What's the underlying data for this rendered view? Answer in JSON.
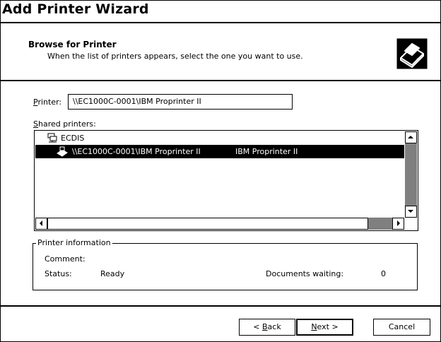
{
  "window": {
    "title": "Add Printer Wizard"
  },
  "header": {
    "title": "Browse for Printer",
    "subtitle": "When the list of printers appears, select the one you want to use.",
    "icon": "printer-icon"
  },
  "printer_field": {
    "label_access": "P",
    "label_rest": "rinter:",
    "value": "\\\\EC1000C-0001\\IBM Proprinter II"
  },
  "shared_printers": {
    "label_access": "S",
    "label_rest": "hared printers:",
    "items": [
      {
        "name": "ECDIS",
        "description": "",
        "icon": "network-domain-icon",
        "selected": false
      },
      {
        "name": "\\\\EC1000C-0001\\IBM Proprinter II",
        "description": "IBM Proprinter II",
        "icon": "printer-icon",
        "selected": true
      }
    ]
  },
  "printer_info": {
    "legend": "Printer information",
    "comment_label": "Comment:",
    "comment_value": "",
    "status_label": "Status:",
    "status_value": "Ready",
    "docs_label": "Documents waiting:",
    "docs_value": "0"
  },
  "buttons": {
    "back_prefix": "< ",
    "back_access": "B",
    "back_rest": "ack",
    "next_access": "N",
    "next_rest": "ext >",
    "cancel": "Cancel"
  }
}
